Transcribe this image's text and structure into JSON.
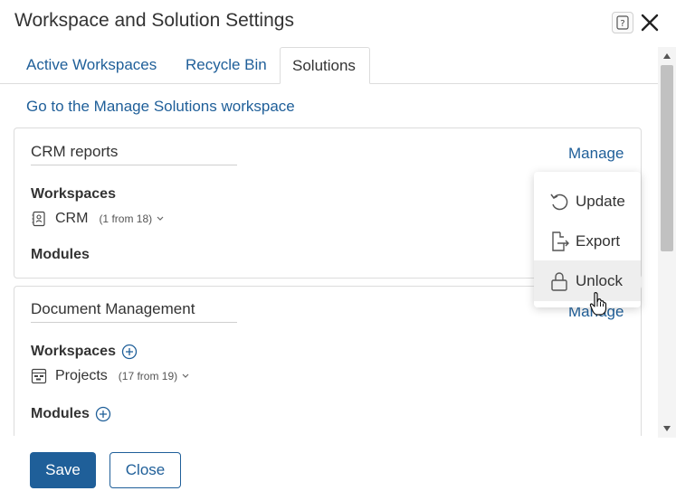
{
  "window": {
    "title": "Workspace and Solution Settings",
    "help_icon": "question-icon",
    "close_icon": "close-icon"
  },
  "tabs": [
    {
      "label": "Active Workspaces",
      "active": false
    },
    {
      "label": "Recycle Bin",
      "active": false
    },
    {
      "label": "Solutions",
      "active": true
    }
  ],
  "goto_link": "Go to the Manage Solutions workspace",
  "solutions": [
    {
      "title": "CRM reports",
      "manage_label": "Manage",
      "workspaces_label": "Workspaces",
      "workspace": {
        "name": "CRM",
        "count": "(1 from 18)",
        "icon": "contact-card-icon"
      },
      "modules_label": "Modules"
    },
    {
      "title": "Document Management",
      "manage_label": "Manage",
      "workspaces_label": "Workspaces",
      "workspace": {
        "name": "Projects",
        "count": "(17 from 19)",
        "icon": "projects-icon"
      },
      "modules_label": "Modules"
    }
  ],
  "manage_menu": [
    {
      "label": "Update",
      "icon": "update-icon"
    },
    {
      "label": "Export",
      "icon": "export-icon"
    },
    {
      "label": "Unlock",
      "icon": "lock-icon",
      "hovered": true
    }
  ],
  "footer": {
    "save_label": "Save",
    "close_label": "Close"
  },
  "colors": {
    "accent": "#1f5f99",
    "border": "#dcdcdc",
    "hover": "#eeeeee"
  }
}
